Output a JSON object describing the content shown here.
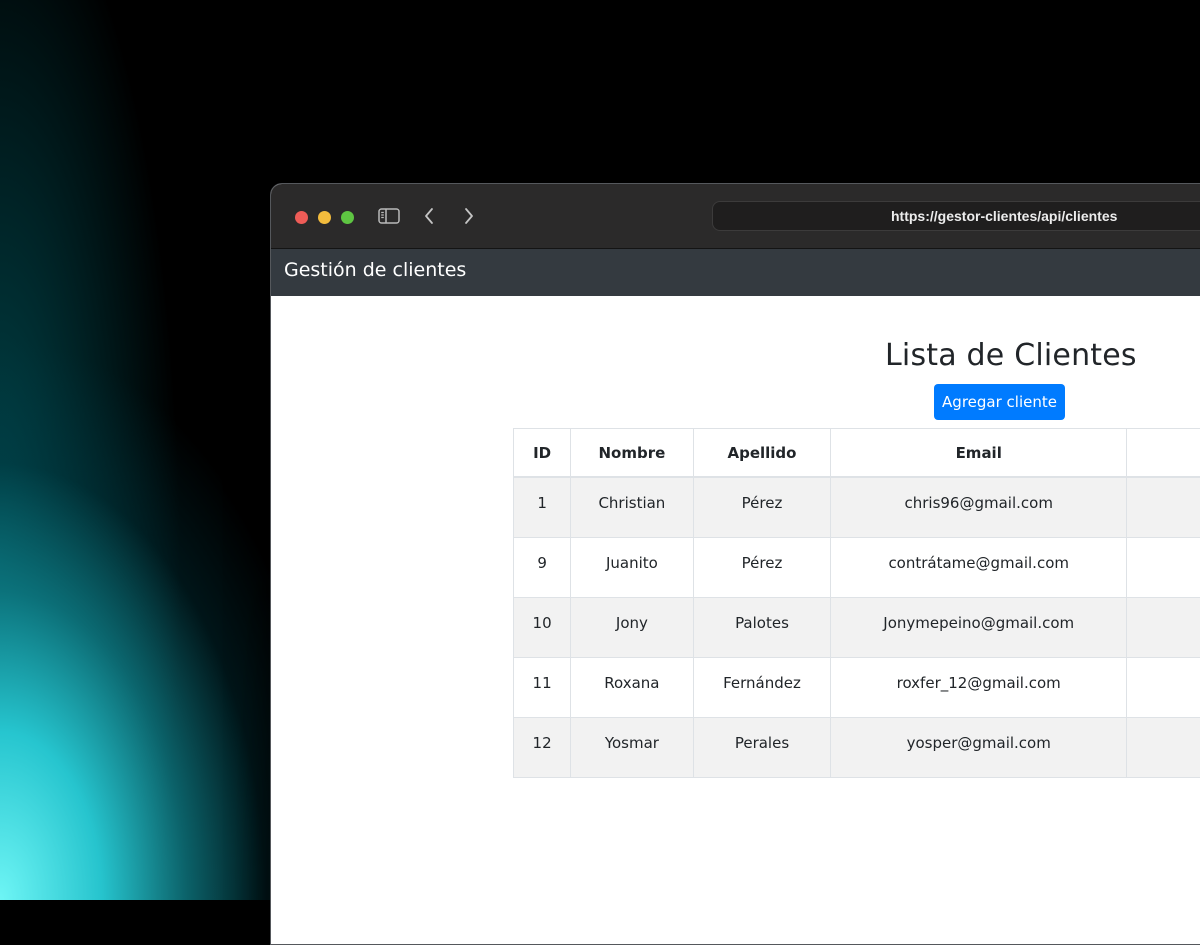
{
  "browser": {
    "url": "https://gestor-clientes/api/clientes",
    "icons": {
      "sidebar": "sidebar-toggle-icon",
      "back": "chevron-left-icon",
      "forward": "chevron-right-icon"
    },
    "traffic_colors": {
      "close": "#ee5c57",
      "minimize": "#f3bc3d",
      "maximize": "#5ec542"
    }
  },
  "navbar": {
    "brand": "Gestión de clientes",
    "background": "#343a40"
  },
  "main": {
    "title": "Lista de Clientes",
    "add_button_label": "Agregar cliente",
    "accent": "#007bff"
  },
  "table": {
    "columns": [
      "ID",
      "Nombre",
      "Apellido",
      "Email",
      ""
    ],
    "rows": [
      {
        "id": "1",
        "nombre": "Christian",
        "apellido": "Pérez",
        "email": "chris96@gmail.com"
      },
      {
        "id": "9",
        "nombre": "Juanito",
        "apellido": "Pérez",
        "email": "contrátame@gmail.com"
      },
      {
        "id": "10",
        "nombre": "Jony",
        "apellido": "Palotes",
        "email": "Jonymepeino@gmail.com"
      },
      {
        "id": "11",
        "nombre": "Roxana",
        "apellido": "Fernández",
        "email": "roxfer_12@gmail.com"
      },
      {
        "id": "12",
        "nombre": "Yosmar",
        "apellido": "Perales",
        "email": "yosper@gmail.com"
      }
    ]
  }
}
